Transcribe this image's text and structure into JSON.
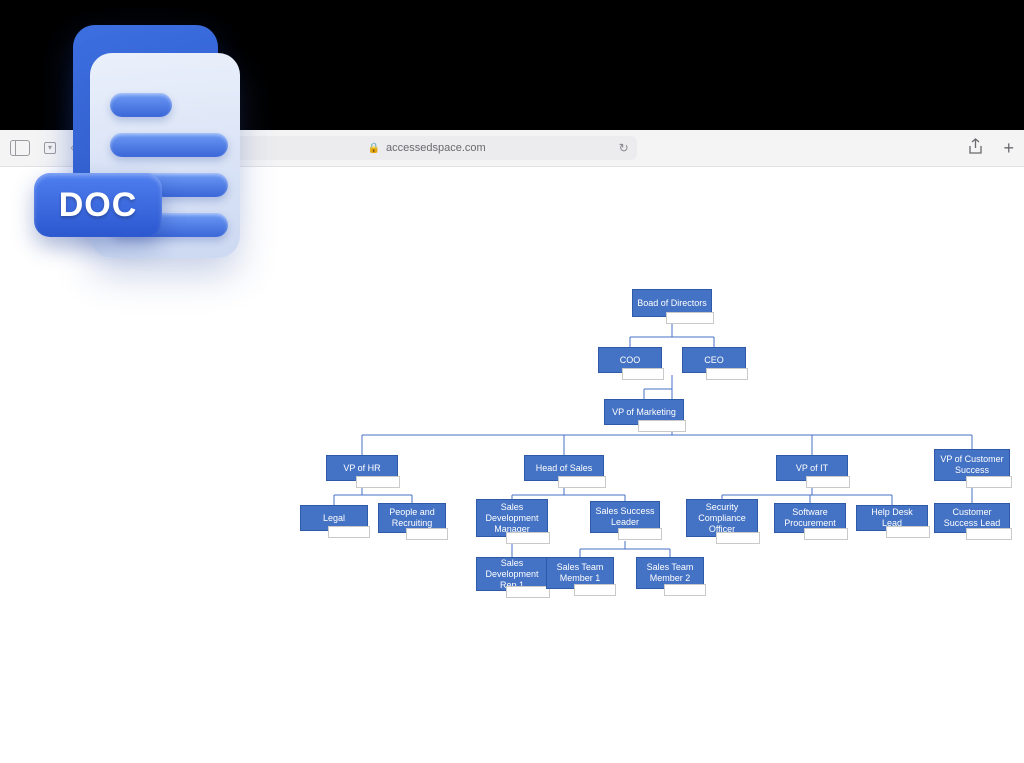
{
  "browser": {
    "address": "accessedspace.com"
  },
  "doc_badge": "DOC",
  "org": {
    "board": {
      "label": "Boad of Directors"
    },
    "coo": {
      "label": "COO"
    },
    "ceo": {
      "label": "CEO"
    },
    "vp_marketing": {
      "label": "VP of Marketing"
    },
    "vp_hr": {
      "label": "VP of HR"
    },
    "head_sales": {
      "label": "Head of Sales"
    },
    "vp_it": {
      "label": "VP of IT"
    },
    "vp_cs": {
      "label": "VP of Customer Success"
    },
    "legal": {
      "label": "Legal"
    },
    "people_rec": {
      "label": "People and Recruiting"
    },
    "sdm": {
      "label": "Sales Development Manager"
    },
    "ssl": {
      "label": "Sales Success Leader"
    },
    "sco": {
      "label": "Security Compliance Officer"
    },
    "sw_proc": {
      "label": "Software Procurement"
    },
    "helpdesk": {
      "label": "Help Desk Lead"
    },
    "cs_lead": {
      "label": "Customer Success Lead"
    },
    "sdr1": {
      "label": "Sales Development Rep 1"
    },
    "stm1": {
      "label": "Sales Team Member 1"
    },
    "stm2": {
      "label": "Sales Team Member 2"
    }
  }
}
